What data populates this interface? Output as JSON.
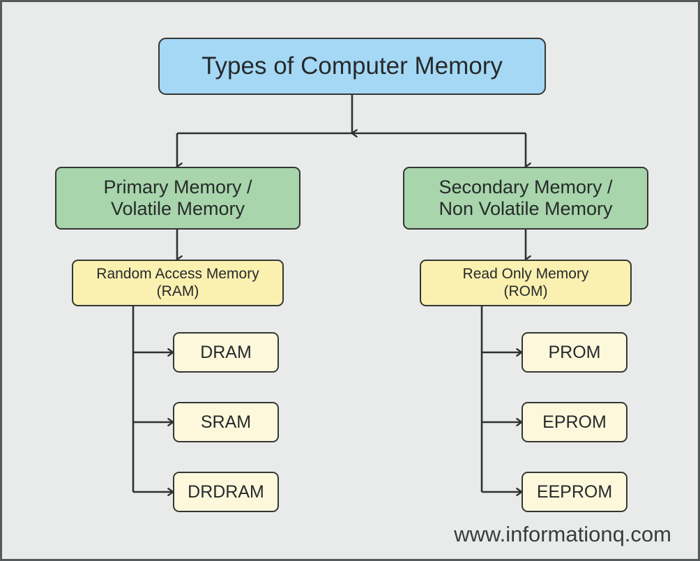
{
  "diagram": {
    "title_box": {
      "label": "Types of Computer Memory",
      "color": "#a5d8f5"
    },
    "branches": [
      {
        "category": {
          "label": "Primary Memory /\nVolatile Memory",
          "color": "#a8d5ab"
        },
        "group": {
          "label": "Random Access Memory\n(RAM)",
          "color": "#faf0b0"
        },
        "items": [
          {
            "label": "DRAM"
          },
          {
            "label": "SRAM"
          },
          {
            "label": "DRDRAM"
          }
        ]
      },
      {
        "category": {
          "label": "Secondary Memory /\nNon Volatile Memory",
          "color": "#a8d5ab"
        },
        "group": {
          "label": "Read Only Memory\n(ROM)",
          "color": "#faf0b0"
        },
        "items": [
          {
            "label": "PROM"
          },
          {
            "label": "EPROM"
          },
          {
            "label": "EEPROM"
          }
        ]
      }
    ],
    "leaf_color": "#fdf8dc",
    "background_color": "#e9ebea",
    "border_color": "#555a5b",
    "connector_color": "#2e3130",
    "watermark": "www.informationq.com"
  }
}
